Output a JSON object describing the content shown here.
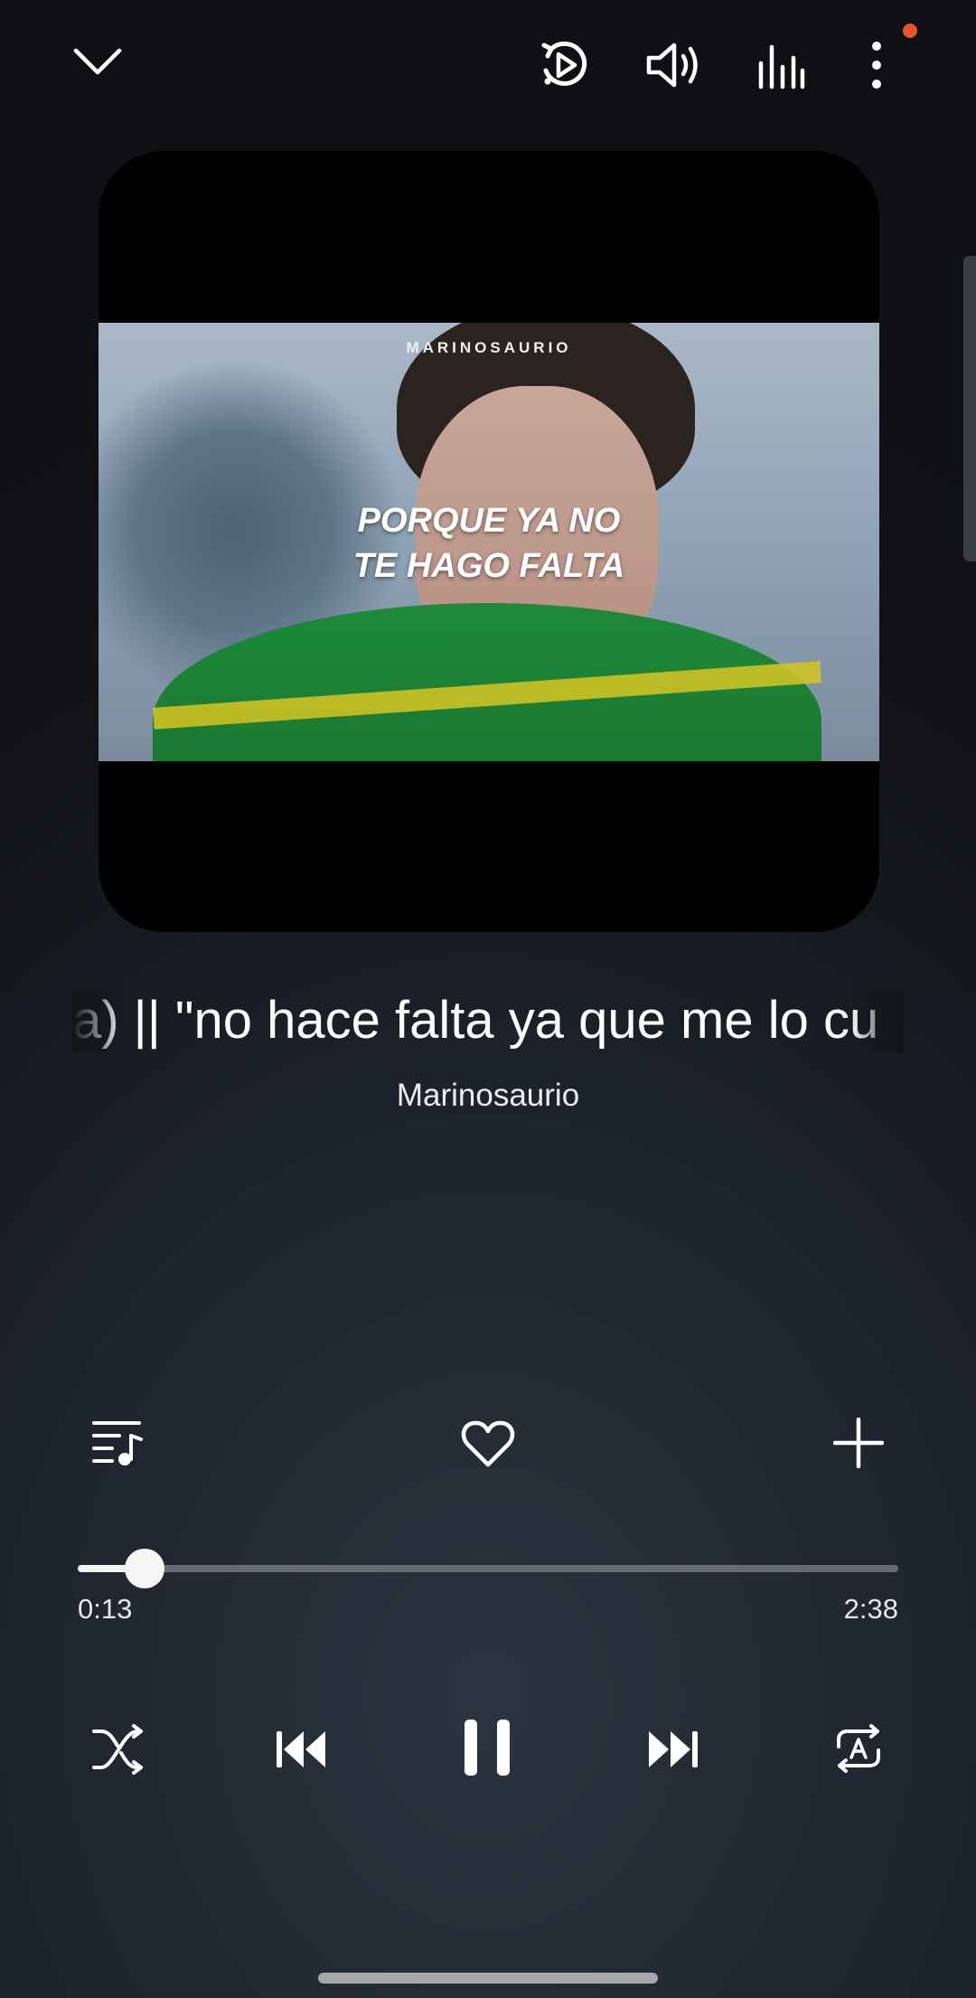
{
  "icons": {
    "collapse": "chevron-down-icon",
    "playback_speed": "play-speed-icon",
    "volume": "volume-icon",
    "equalizer": "equalizer-icon",
    "more": "more-vertical-icon",
    "queue": "queue-music-icon",
    "favorite": "heart-icon",
    "add": "plus-icon",
    "shuffle": "shuffle-icon",
    "previous": "skip-previous-icon",
    "pause": "pause-icon",
    "next": "skip-next-icon",
    "repeat": "repeat-icon"
  },
  "colors": {
    "notification": "#e8542a",
    "accent": "#ffffff"
  },
  "album_art": {
    "brand": "MARINOSAURIO",
    "overlay_line1": "PORQUE YA NO",
    "overlay_line2": "TE HAGO FALTA"
  },
  "track": {
    "title": "a) || \"no hace falta ya que me lo cu",
    "artist": "Marinosaurio"
  },
  "progress": {
    "elapsed": "0:13",
    "duration": "2:38",
    "fraction": 0.082
  }
}
